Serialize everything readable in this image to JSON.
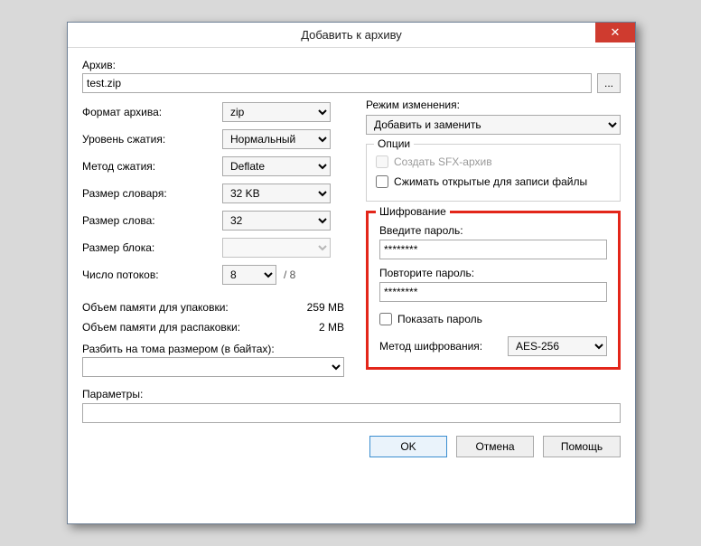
{
  "title": "Добавить к архиву",
  "archive": {
    "label": "Архив:",
    "value": "test.zip",
    "browse_label": "..."
  },
  "left": {
    "format_label": "Формат архива:",
    "format_value": "zip",
    "level_label": "Уровень сжатия:",
    "level_value": "Нормальный",
    "method_label": "Метод сжатия:",
    "method_value": "Deflate",
    "dict_label": "Размер словаря:",
    "dict_value": "32 KB",
    "word_label": "Размер слова:",
    "word_value": "32",
    "block_label": "Размер блока:",
    "block_value": "",
    "threads_label": "Число потоков:",
    "threads_value": "8",
    "threads_suffix": "/ 8",
    "mem_pack_label": "Объем памяти для упаковки:",
    "mem_pack_value": "259 MB",
    "mem_unpack_label": "Объем памяти для распаковки:",
    "mem_unpack_value": "2 MB",
    "split_label": "Разбить на тома размером (в байтах):"
  },
  "right": {
    "mode_label": "Режим изменения:",
    "mode_value": "Добавить и заменить",
    "options_legend": "Опции",
    "opt_sfx": "Создать SFX-архив",
    "opt_compress_open": "Сжимать открытые для записи файлы",
    "enc_legend": "Шифрование",
    "enc_pass1_label": "Введите пароль:",
    "enc_pass1_value": "********",
    "enc_pass2_label": "Повторите пароль:",
    "enc_pass2_value": "********",
    "enc_show": "Показать пароль",
    "enc_method_label": "Метод шифрования:",
    "enc_method_value": "AES-256"
  },
  "params_label": "Параметры:",
  "buttons": {
    "ok": "OK",
    "cancel": "Отмена",
    "help": "Помощь"
  }
}
